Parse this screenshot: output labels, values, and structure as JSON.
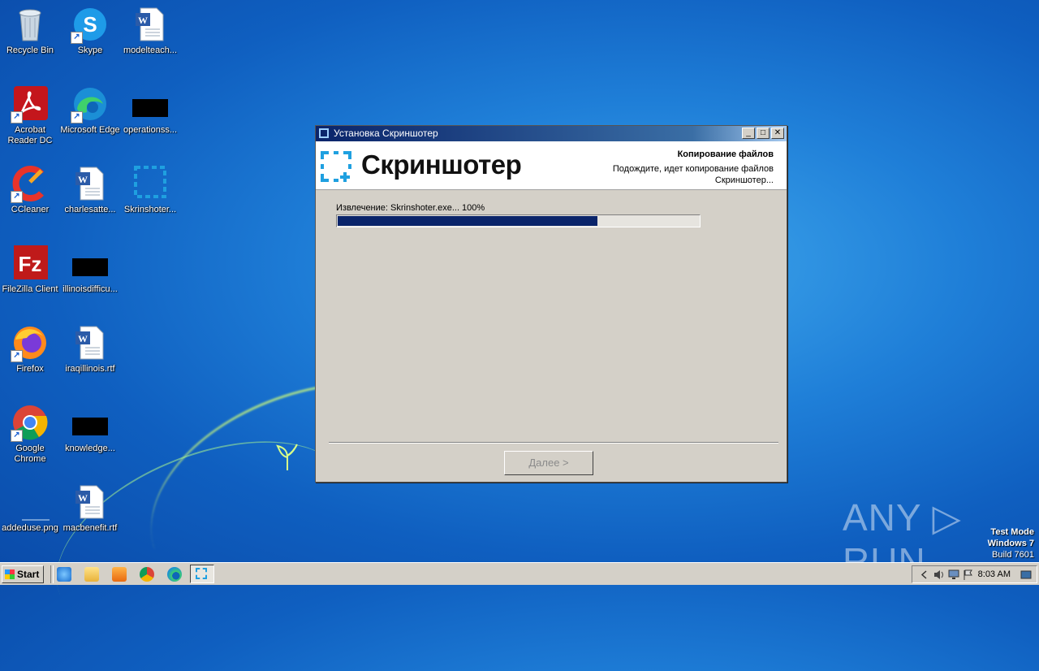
{
  "desktop": {
    "icons": [
      {
        "label": "Recycle Bin",
        "icon": "recycle-bin-icon"
      },
      {
        "label": "Skype",
        "icon": "skype-icon"
      },
      {
        "label": "modelteach...",
        "icon": "word-doc-icon"
      },
      {
        "label": "Acrobat Reader DC",
        "icon": "acrobat-icon"
      },
      {
        "label": "Microsoft Edge",
        "icon": "edge-icon"
      },
      {
        "label": "operationss...",
        "icon": "black-thumb-icon"
      },
      {
        "label": "CCleaner",
        "icon": "ccleaner-icon"
      },
      {
        "label": "charlesatte...",
        "icon": "word-doc-icon"
      },
      {
        "label": "Skrinshoter...",
        "icon": "skrinshoter-icon"
      },
      {
        "label": "FileZilla Client",
        "icon": "filezilla-icon"
      },
      {
        "label": "illinoisdifficu...",
        "icon": "black-thumb-icon"
      },
      {
        "label": "Firefox",
        "icon": "firefox-icon"
      },
      {
        "label": "iraqillinois.rtf",
        "icon": "word-doc-icon"
      },
      {
        "label": "Google Chrome",
        "icon": "chrome-icon"
      },
      {
        "label": "knowledge...",
        "icon": "black-thumb-icon"
      },
      {
        "label": "addeduse.png",
        "icon": "png-thumb-icon"
      },
      {
        "label": "macbenefit.rtf",
        "icon": "word-doc-icon"
      }
    ]
  },
  "window": {
    "title": "Установка Скриншотер",
    "logo_text": "Скриншотер",
    "header_title": "Копирование файлов",
    "header_subtitle": "Подождите, идет копирование файлов Скриншотер...",
    "status": "Извлечение: Skrinshoter.exe... 100%",
    "progress": 0.72,
    "next_label": "Далее >",
    "minimize": "_",
    "maximize": "□",
    "close": "✕"
  },
  "watermark": {
    "text": "ANY ▷ RUN"
  },
  "test_mode": {
    "line1": "Test Mode",
    "line2": "Windows 7",
    "line3": "Build 7601"
  },
  "taskbar": {
    "start_label": "Start",
    "clock": "8:03 AM"
  },
  "colors": {
    "title_bar": "#0a246a",
    "progress": "#0a246a",
    "accent_blue": "#1fa0e0"
  }
}
